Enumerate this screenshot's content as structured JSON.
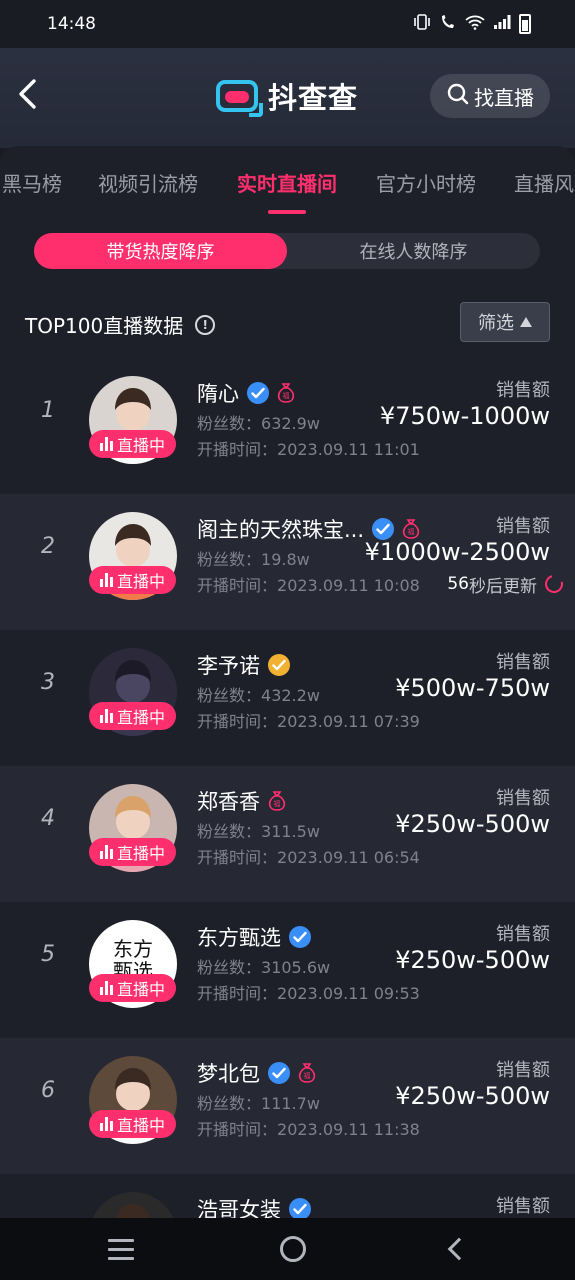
{
  "status_bar": {
    "time": "14:48",
    "icons": [
      "vibrate-icon",
      "wifi-call-icon",
      "wifi-icon",
      "signal-icon",
      "battery-icon"
    ]
  },
  "header": {
    "brand_name": "抖查查",
    "search_label": "找直播",
    "icons": [
      "back-icon",
      "logo-icon",
      "search-icon"
    ]
  },
  "tabs": [
    {
      "label": "黑马榜",
      "active": false
    },
    {
      "label": "视频引流榜",
      "active": false
    },
    {
      "label": "实时直播间",
      "active": true
    },
    {
      "label": "官方小时榜",
      "active": false
    },
    {
      "label": "直播风",
      "active": false
    }
  ],
  "sort_options": [
    {
      "label": "带货热度降序",
      "active": true
    },
    {
      "label": "在线人数降序",
      "active": false
    }
  ],
  "section": {
    "title": "TOP100直播数据",
    "filter_label": "筛选"
  },
  "row_labels": {
    "live_badge": "直播中",
    "sales_label": "销售额",
    "fans_prefix": "粉丝数：",
    "start_prefix": "开播时间："
  },
  "update_notice": {
    "seconds": "56",
    "text": "秒后更新"
  },
  "rows": [
    {
      "rank": "1",
      "name": "隋心",
      "verified": "blue",
      "has_bag": true,
      "fans": "632.9w",
      "start_time": "2023.09.11 11:01",
      "sales": "¥750w-1000w",
      "avatar_bg": "#d9d4cf"
    },
    {
      "rank": "2",
      "name": "阁主的天然珠宝...",
      "verified": "blue",
      "has_bag": true,
      "fans": "19.8w",
      "start_time": "2023.09.11 10:08",
      "sales": "¥1000w-2500w",
      "avatar_bg": "#e9e7e3"
    },
    {
      "rank": "3",
      "name": "李予诺",
      "verified": "gold",
      "has_bag": false,
      "fans": "432.2w",
      "start_time": "2023.09.11 07:39",
      "sales": "¥500w-750w",
      "avatar_bg": "#2c2a3a"
    },
    {
      "rank": "4",
      "name": "郑香香",
      "verified": "none",
      "has_bag": true,
      "fans": "311.5w",
      "start_time": "2023.09.11 06:54",
      "sales": "¥250w-500w",
      "avatar_bg": "#c9b6b1"
    },
    {
      "rank": "5",
      "name": "东方甄选",
      "verified": "blue",
      "has_bag": false,
      "fans": "3105.6w",
      "start_time": "2023.09.11 09:53",
      "sales": "¥250w-500w",
      "avatar_bg": "#ffffff"
    },
    {
      "rank": "6",
      "name": "梦北包",
      "verified": "blue",
      "has_bag": true,
      "fans": "111.7w",
      "start_time": "2023.09.11 11:38",
      "sales": "¥250w-500w",
      "avatar_bg": "#5e4a3a"
    },
    {
      "rank": "",
      "name": "浩哥女装",
      "verified": "blue",
      "has_bag": false,
      "fans": "",
      "start_time": "",
      "sales": "",
      "avatar_bg": "#2a2a2a"
    }
  ],
  "logo_text_row5": "东方\n甄选",
  "colors": {
    "accent": "#ff2f6d",
    "verify_blue": "#3a8ff6",
    "verify_gold": "#f2b131",
    "logo_blue": "#35c3f0"
  }
}
